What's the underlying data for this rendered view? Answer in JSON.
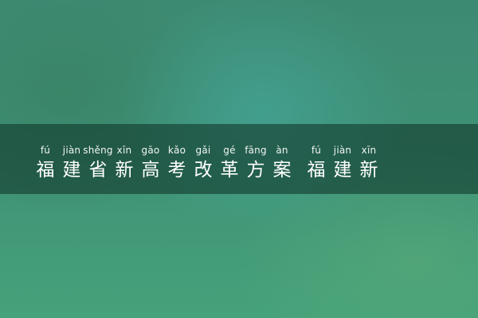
{
  "banner": {
    "characters": [
      {
        "pinyin": "fú",
        "hanzi": "福"
      },
      {
        "pinyin": "jiàn",
        "hanzi": "建"
      },
      {
        "pinyin": "shěng",
        "hanzi": "省"
      },
      {
        "pinyin": "xīn",
        "hanzi": "新"
      },
      {
        "pinyin": "gāo",
        "hanzi": "高"
      },
      {
        "pinyin": "kǎo",
        "hanzi": "考"
      },
      {
        "pinyin": "gǎi",
        "hanzi": "改"
      },
      {
        "pinyin": "gé",
        "hanzi": "革"
      },
      {
        "pinyin": "fāng",
        "hanzi": "方"
      },
      {
        "pinyin": "àn",
        "hanzi": "案"
      },
      {
        "pinyin": "fú",
        "hanzi": "福"
      },
      {
        "pinyin": "jiàn",
        "hanzi": "建"
      },
      {
        "pinyin": "xīn",
        "hanzi": "新"
      }
    ]
  },
  "colors": {
    "background": "#3f9276",
    "band": "#123a2d",
    "text": "#ffffff"
  }
}
